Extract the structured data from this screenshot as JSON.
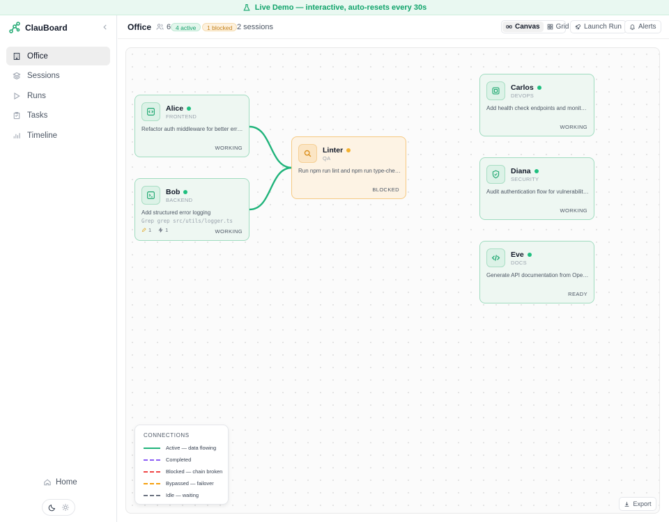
{
  "banner": {
    "text": "Live Demo — interactive, auto-resets every 30s",
    "icon": "flask-icon",
    "color": "#10a36a"
  },
  "app": {
    "name": "ClauBoard"
  },
  "sidebar": {
    "items": [
      {
        "label": "Office",
        "icon": "building-icon",
        "active": true
      },
      {
        "label": "Sessions",
        "icon": "layers-icon"
      },
      {
        "label": "Runs",
        "icon": "play-icon"
      },
      {
        "label": "Tasks",
        "icon": "clipboard-icon"
      },
      {
        "label": "Timeline",
        "icon": "chart-icon"
      }
    ],
    "home_label": "Home"
  },
  "header": {
    "title": "Office",
    "agent_count": "6",
    "active_badge": "4 active",
    "blocked_badge": "1 blocked",
    "sessions": "2 sessions",
    "view_canvas": "Canvas",
    "view_grid": "Grid",
    "launch_label": "Launch Run",
    "alerts_label": "Alerts"
  },
  "agents": [
    {
      "name": "Alice",
      "role": "FRONTEND",
      "task": "Refactor auth middleware for better error ...",
      "status": "WORKING",
      "icon": "code-icon"
    },
    {
      "name": "Bob",
      "role": "BACKEND",
      "task": "Add structured error logging",
      "command": "Grep grep src/utils/logger.ts",
      "edits": "1",
      "tools": "1",
      "status": "WORKING",
      "icon": "terminal-icon"
    },
    {
      "name": "Linter",
      "role": "QA",
      "task": "Run npm run lint and npm run type-check...",
      "status": "BLOCKED",
      "icon": "search-icon"
    },
    {
      "name": "Carlos",
      "role": "DEVOPS",
      "task": "Add health check endpoints and monitori...",
      "status": "WORKING",
      "icon": "server-icon"
    },
    {
      "name": "Diana",
      "role": "SECURITY",
      "task": "Audit authentication flow for vulnerabilities",
      "status": "WORKING",
      "icon": "shield-icon"
    },
    {
      "name": "Eve",
      "role": "DOCS",
      "task": "Generate API documentation from OpenA...",
      "status": "READY",
      "icon": "code-brackets-icon"
    }
  ],
  "legend": {
    "title": "CONNECTIONS",
    "items": [
      {
        "label": "Active — data flowing",
        "color": "#1fb37a"
      },
      {
        "label": "Completed",
        "color": "#8b5cf6"
      },
      {
        "label": "Blocked — chain broken",
        "color": "#ef4444"
      },
      {
        "label": "Bypassed — failover",
        "color": "#f59e0b"
      },
      {
        "label": "Idle — waiting",
        "color": "#6b7280"
      }
    ]
  },
  "export_label": "Export"
}
